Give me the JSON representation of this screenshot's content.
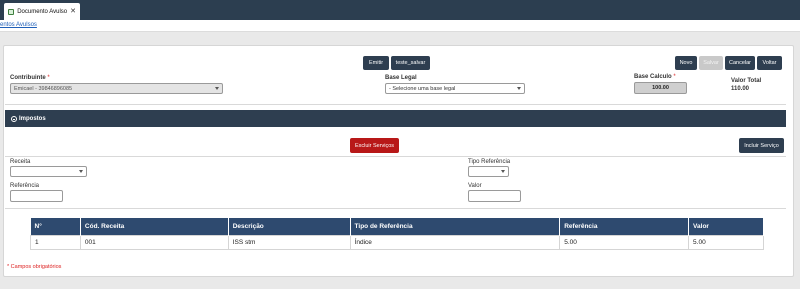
{
  "window": {
    "tab_title": "Documento Avulso",
    "tab_close": "✕",
    "breadcrumb": "entos Avulsos"
  },
  "toolbar": {
    "emitir": "Emitir",
    "teste_salvar": "teste_salvar",
    "novo": "Novo",
    "salvar": "Salvar",
    "cancelar": "Cancelar",
    "voltar": "Voltar"
  },
  "form": {
    "contribuinte_label": "Contribuinte",
    "contribuinte_value": "Emicael - 39846896085",
    "base_legal_label": "Base Legal",
    "base_legal_value": "- Selecione uma base legal",
    "base_calculo_label": "Base Calculo",
    "base_calculo_value": "100.00",
    "valor_total_label": "Valor Total",
    "valor_total_value": "110.00",
    "required_mark": "*"
  },
  "impostos": {
    "section_title": "Impostos",
    "excluir_servicos": "Excluir Serviços",
    "incluir_servico": "Incluir Serviço",
    "receita_label": "Receita",
    "receita_value": "",
    "tipo_referencia_label": "Tipo Referência",
    "tipo_referencia_value": "",
    "referencia_label": "Referência",
    "referencia_value": "",
    "valor_label": "Valor",
    "valor_value": ""
  },
  "table": {
    "headers": [
      "N°",
      "Cód. Receita",
      "Descrição",
      "Tipo de Referência",
      "Referência",
      "Valor"
    ],
    "rows": [
      [
        "1",
        "001",
        "ISS stm",
        "Índice",
        "5.00",
        "5.00"
      ]
    ]
  },
  "footer_note": "* Campos obrigatórios",
  "colors": {
    "navy": "#2c3e50",
    "table_header": "#2e4a6f",
    "danger": "#b81818",
    "required": "#dd2222"
  }
}
